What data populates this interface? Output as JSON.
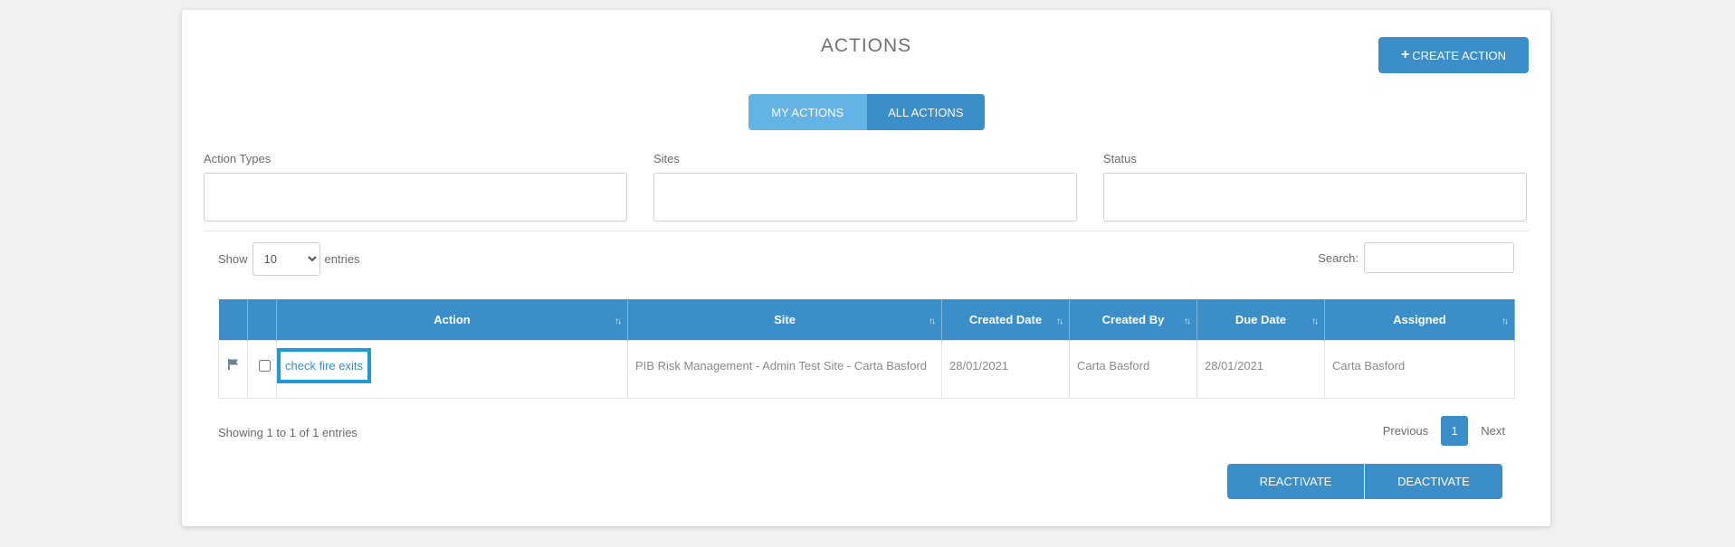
{
  "page": {
    "title": "ACTIONS"
  },
  "toolbar": {
    "create_label": "CREATE ACTION",
    "create_icon": "plus-icon"
  },
  "tabs": [
    {
      "label": "MY ACTIONS",
      "active": true
    },
    {
      "label": "ALL ACTIONS",
      "active": false
    }
  ],
  "filters": {
    "action_types": {
      "label": "Action Types",
      "value": ""
    },
    "sites": {
      "label": "Sites",
      "value": ""
    },
    "status": {
      "label": "Status",
      "value": ""
    }
  },
  "length_menu": {
    "prefix": "Show",
    "value": "10",
    "suffix": "entries"
  },
  "search": {
    "label": "Search:",
    "value": ""
  },
  "table": {
    "columns": [
      "",
      "",
      "Action",
      "Site",
      "Created Date",
      "Created By",
      "Due Date",
      "Assigned"
    ],
    "rows": [
      {
        "flag_icon": "flag-icon",
        "action": "check fire exits",
        "site": "PIB Risk Management - Admin Test Site - Carta Basford",
        "created_date": "28/01/2021",
        "created_by": "Carta Basford",
        "due_date": "28/01/2021",
        "assigned": "Carta Basford"
      }
    ]
  },
  "info": "Showing 1 to 1 of 1 entries",
  "pagination": {
    "previous": "Previous",
    "current": "1",
    "next": "Next"
  },
  "bottom_buttons": {
    "reactivate": "REACTIVATE",
    "deactivate": "DEACTIVATE"
  },
  "colors": {
    "accent": "#3b8ec8",
    "accent_light": "#63b3e5",
    "highlight": "#1e9bd7"
  }
}
